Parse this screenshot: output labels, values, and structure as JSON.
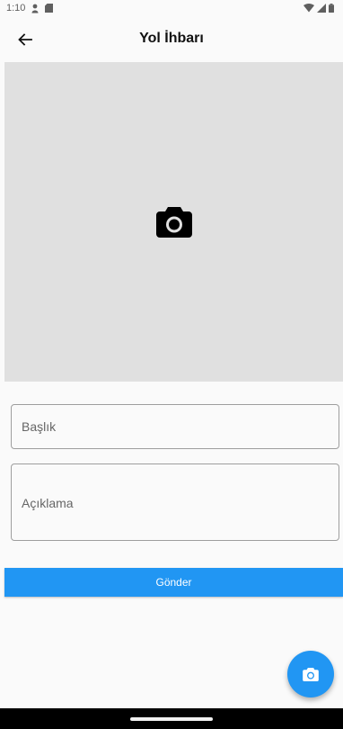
{
  "status_bar": {
    "time": "1:10",
    "icons": [
      "person-pin-icon",
      "sd-card-icon",
      "wifi-icon",
      "cellular-signal-icon",
      "battery-icon"
    ]
  },
  "app_bar": {
    "title": "Yol İhbarı",
    "back_icon": "arrow-back-icon"
  },
  "image_picker": {
    "icon": "camera-icon"
  },
  "form": {
    "title_placeholder": "Başlık",
    "description_placeholder": "Açıklama",
    "submit_label": "Gönder"
  },
  "fab": {
    "icon": "camera-icon"
  },
  "colors": {
    "accent": "#2196f3",
    "background": "#fafafa",
    "image_placeholder": "#e0e0e0",
    "field_border": "#9e9e9e"
  }
}
